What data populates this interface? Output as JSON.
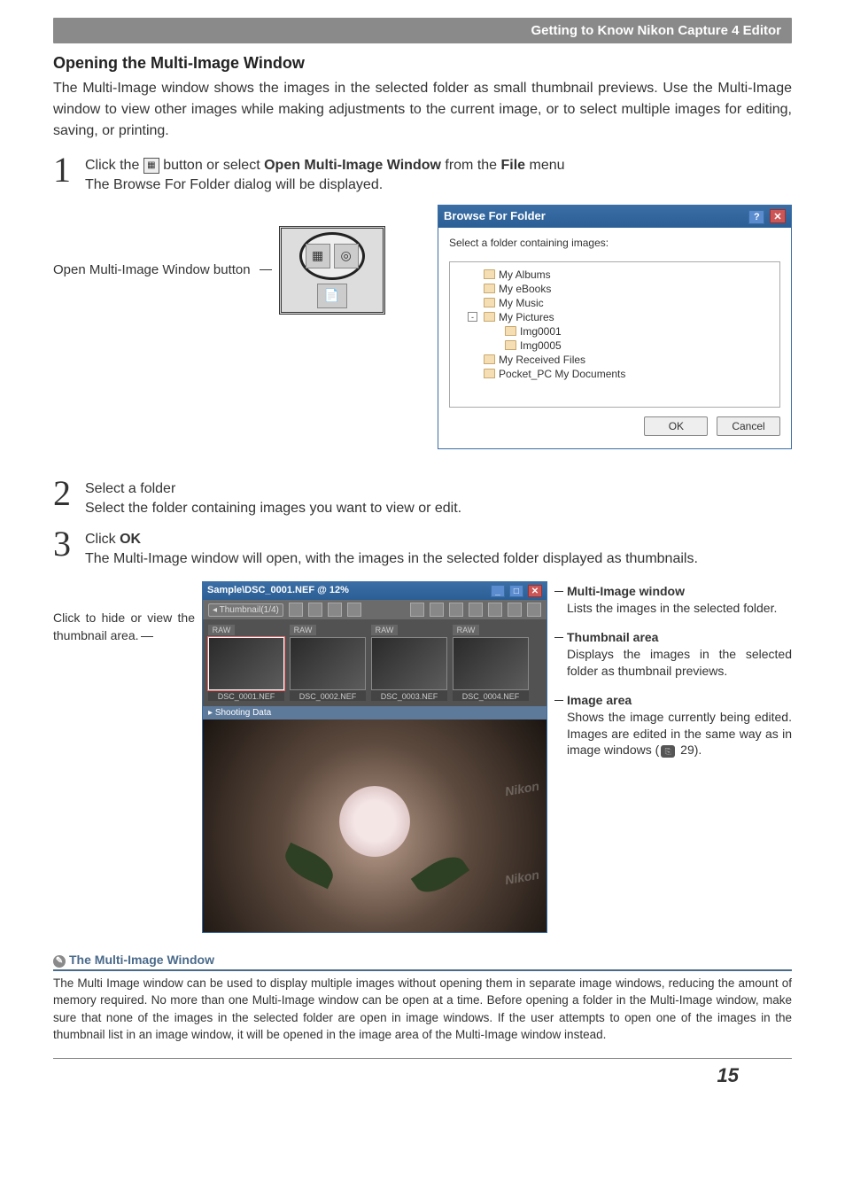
{
  "header_bar": "Getting to Know Nikon Capture 4 Editor",
  "section_heading": "Opening the Multi-Image Window",
  "intro": "The Multi-Image window shows the images in the selected folder as small thumbnail previews.  Use the Multi-Image window to view other images while making adjustments to the current image, or to select multiple images for editing, saving, or printing.",
  "steps": {
    "s1": {
      "num": "1",
      "title_pre": "Click the ",
      "title_mid": " button or select ",
      "title_bold1": "Open Multi-Image Window",
      "title_mid2": " from the ",
      "title_bold2": "File",
      "title_post": " menu",
      "desc": "The Browse For Folder dialog will be displayed."
    },
    "s2": {
      "num": "2",
      "title": "Select a folder",
      "desc": "Select the folder containing images you want to view or edit."
    },
    "s3": {
      "num": "3",
      "title_pre": "Click ",
      "title_bold": "OK",
      "desc": "The Multi-Image window will open, with the images in the selected folder displayed as thumbnails."
    }
  },
  "button_label": "Open Multi-Image Window button",
  "browse_dialog": {
    "title": "Browse For Folder",
    "instruction": "Select a folder containing images:",
    "tree": [
      {
        "label": "My Albums",
        "indent": 1
      },
      {
        "label": "My eBooks",
        "indent": 1
      },
      {
        "label": "My Music",
        "indent": 1
      },
      {
        "label": "My Pictures",
        "indent": 1,
        "expander": "-"
      },
      {
        "label": "Img0001",
        "indent": 2
      },
      {
        "label": "Img0005",
        "indent": 2
      },
      {
        "label": "My Received Files",
        "indent": 1
      },
      {
        "label": "Pocket_PC My Documents",
        "indent": 1
      }
    ],
    "ok": "OK",
    "cancel": "Cancel"
  },
  "fig_left_caption": "Click to hide or view the thumbnail area.",
  "mi_window": {
    "title": "Sample\\DSC_0001.NEF @ 12%",
    "thumb_label": "Thumbnail(1/4)",
    "badges": [
      "RAW",
      "RAW",
      "RAW",
      "RAW"
    ],
    "names": [
      "DSC_0001.NEF",
      "DSC_0002.NEF",
      "DSC_0003.NEF",
      "DSC_0004.NEF"
    ],
    "section_bar": "Shooting Data",
    "watermark": "Nikon"
  },
  "annotations": {
    "a1": {
      "title": "Multi-Image window",
      "desc": "Lists the images in the selected folder."
    },
    "a2": {
      "title": "Thumbnail area",
      "desc": "Displays the images in the selected folder as thumbnail previews."
    },
    "a3": {
      "title": "Image area",
      "desc_pre": "Shows the image currently being edited.  Images are edited in the same way as in image windows (",
      "desc_post": " 29)."
    }
  },
  "tip": {
    "heading": "The Multi-Image Window",
    "body": "The Multi Image window can be used to display multiple images without opening them in separate image windows, reducing the amount of memory required.  No more than one Multi-Image window can be open at a time.  Before opening a folder in the Multi-Image window, make sure that none of the images in the selected folder are open in image windows.  If the user attempts to open one of the images in the thumbnail list in an image window, it will be opened in the image area of the Multi-Image window instead."
  },
  "page_number": "15"
}
